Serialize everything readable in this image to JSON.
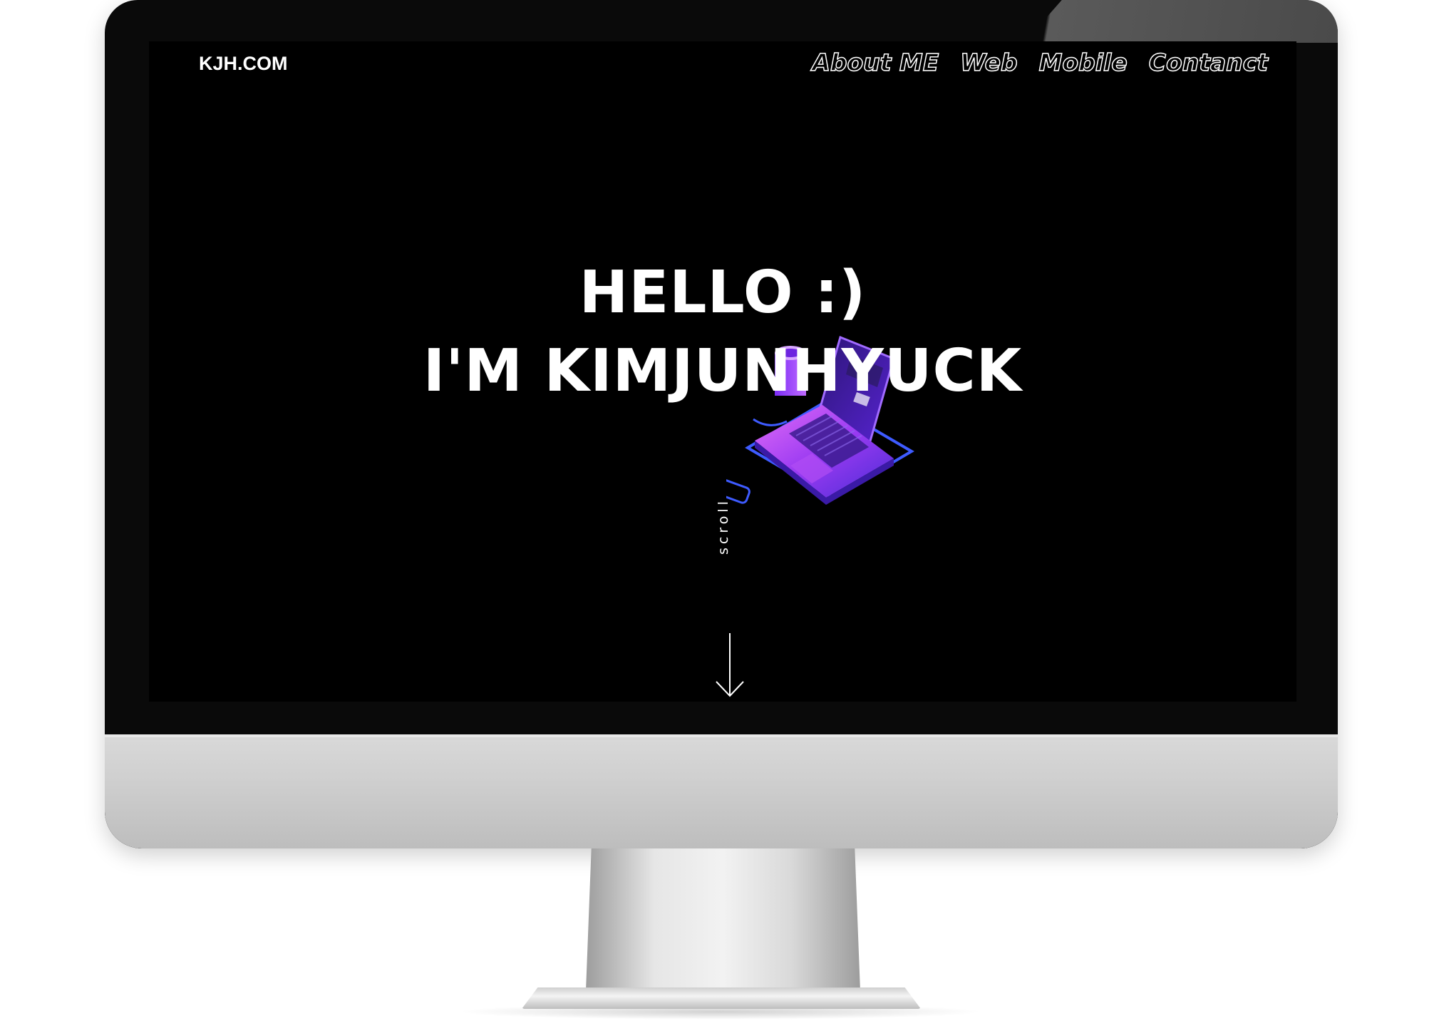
{
  "site": {
    "logo": "KJH.COM",
    "nav": [
      "About ME",
      "Web",
      "Mobile",
      "Contanct"
    ],
    "hero_line1": "HELLO :)",
    "hero_line2": "I'M KIMJUNHYUCK",
    "scroll_label": "scroll"
  },
  "icons": {
    "illustration": "isometric-laptop-illustration",
    "scroll_arrow": "arrow-down-icon"
  },
  "colors": {
    "background": "#000000",
    "text": "#ffffff",
    "accent_purple": "#7b2cf5",
    "accent_pink": "#c34dff",
    "accent_blue": "#3b4fff"
  }
}
